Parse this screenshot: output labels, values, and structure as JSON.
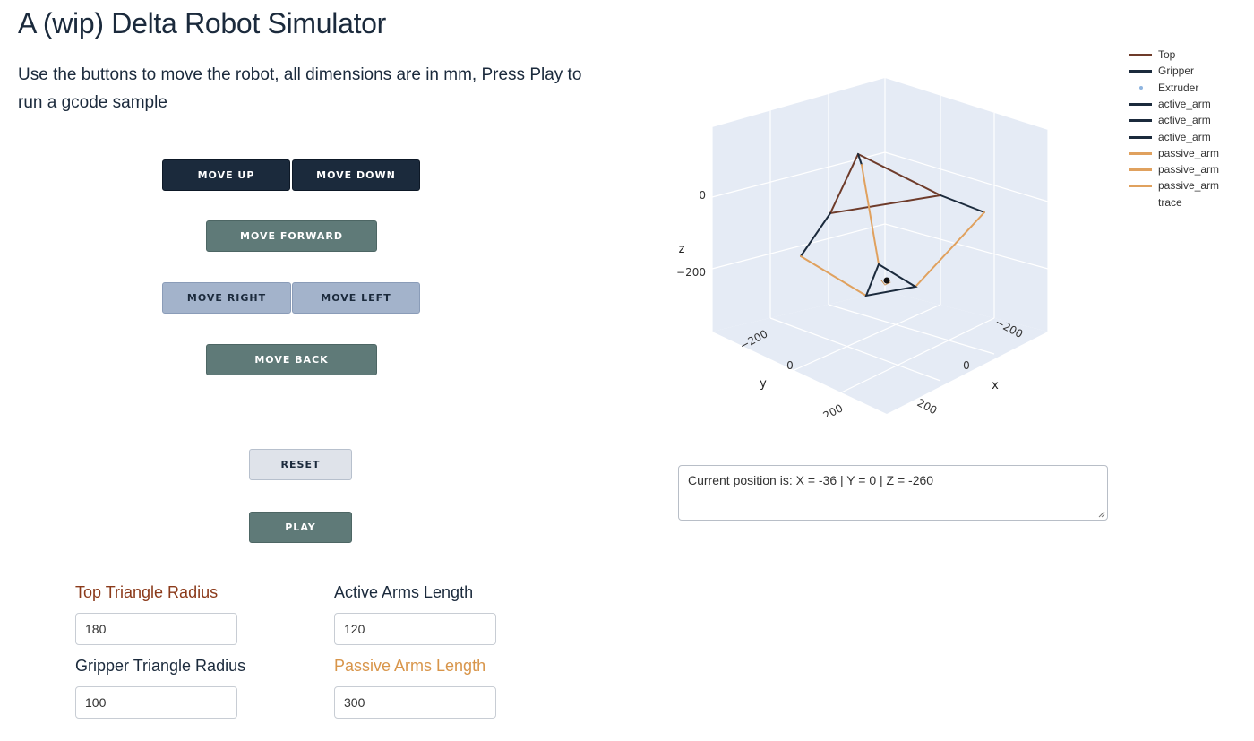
{
  "page": {
    "title": "A (wip) Delta Robot Simulator",
    "subtitle": "Use the buttons to move the robot, all dimensions are in mm, Press Play to run a gcode sample"
  },
  "controls": {
    "move_up": "MOVE UP",
    "move_down": "MOVE DOWN",
    "move_forward": "MOVE FORWARD",
    "move_right": "MOVE RIGHT",
    "move_left": "MOVE LEFT",
    "move_back": "MOVE BACK",
    "reset": "RESET",
    "play": "PLAY"
  },
  "parameters": {
    "top_radius": {
      "label": "Top Triangle Radius",
      "value": "180",
      "color": "#8b3a1a"
    },
    "active_arms": {
      "label": "Active Arms Length",
      "value": "120",
      "color": "#1b2a3c"
    },
    "gripper_radius": {
      "label": "Gripper Triangle Radius",
      "value": "100",
      "color": "#1b2a3c"
    },
    "passive_arms": {
      "label": "Passive Arms Length",
      "value": "300",
      "color": "#d8954a"
    }
  },
  "status": {
    "position_text": "Current position is: X = -36 | Y = 0 | Z = -260"
  },
  "plot": {
    "z_axis": {
      "title": "z",
      "ticks": [
        "0",
        "−200"
      ]
    },
    "y_axis": {
      "title": "y",
      "ticks": [
        "−200",
        "0",
        "200"
      ]
    },
    "x_axis": {
      "title": "x",
      "ticks": [
        "−200",
        "0",
        "200"
      ]
    },
    "legend": [
      {
        "name": "Top",
        "color": "#6e3b2a",
        "style": "line"
      },
      {
        "name": "Gripper",
        "color": "#1b2a3c",
        "style": "line"
      },
      {
        "name": "Extruder",
        "color": "#8fb5e0",
        "style": "dot"
      },
      {
        "name": "active_arm",
        "color": "#1b2a3c",
        "style": "line"
      },
      {
        "name": "active_arm",
        "color": "#1b2a3c",
        "style": "line"
      },
      {
        "name": "active_arm",
        "color": "#1b2a3c",
        "style": "line"
      },
      {
        "name": "passive_arm",
        "color": "#e0a15e",
        "style": "line"
      },
      {
        "name": "passive_arm",
        "color": "#e0a15e",
        "style": "line"
      },
      {
        "name": "passive_arm",
        "color": "#e0a15e",
        "style": "line"
      },
      {
        "name": "trace",
        "color": "#c58a4a",
        "style": "dotted"
      }
    ]
  }
}
